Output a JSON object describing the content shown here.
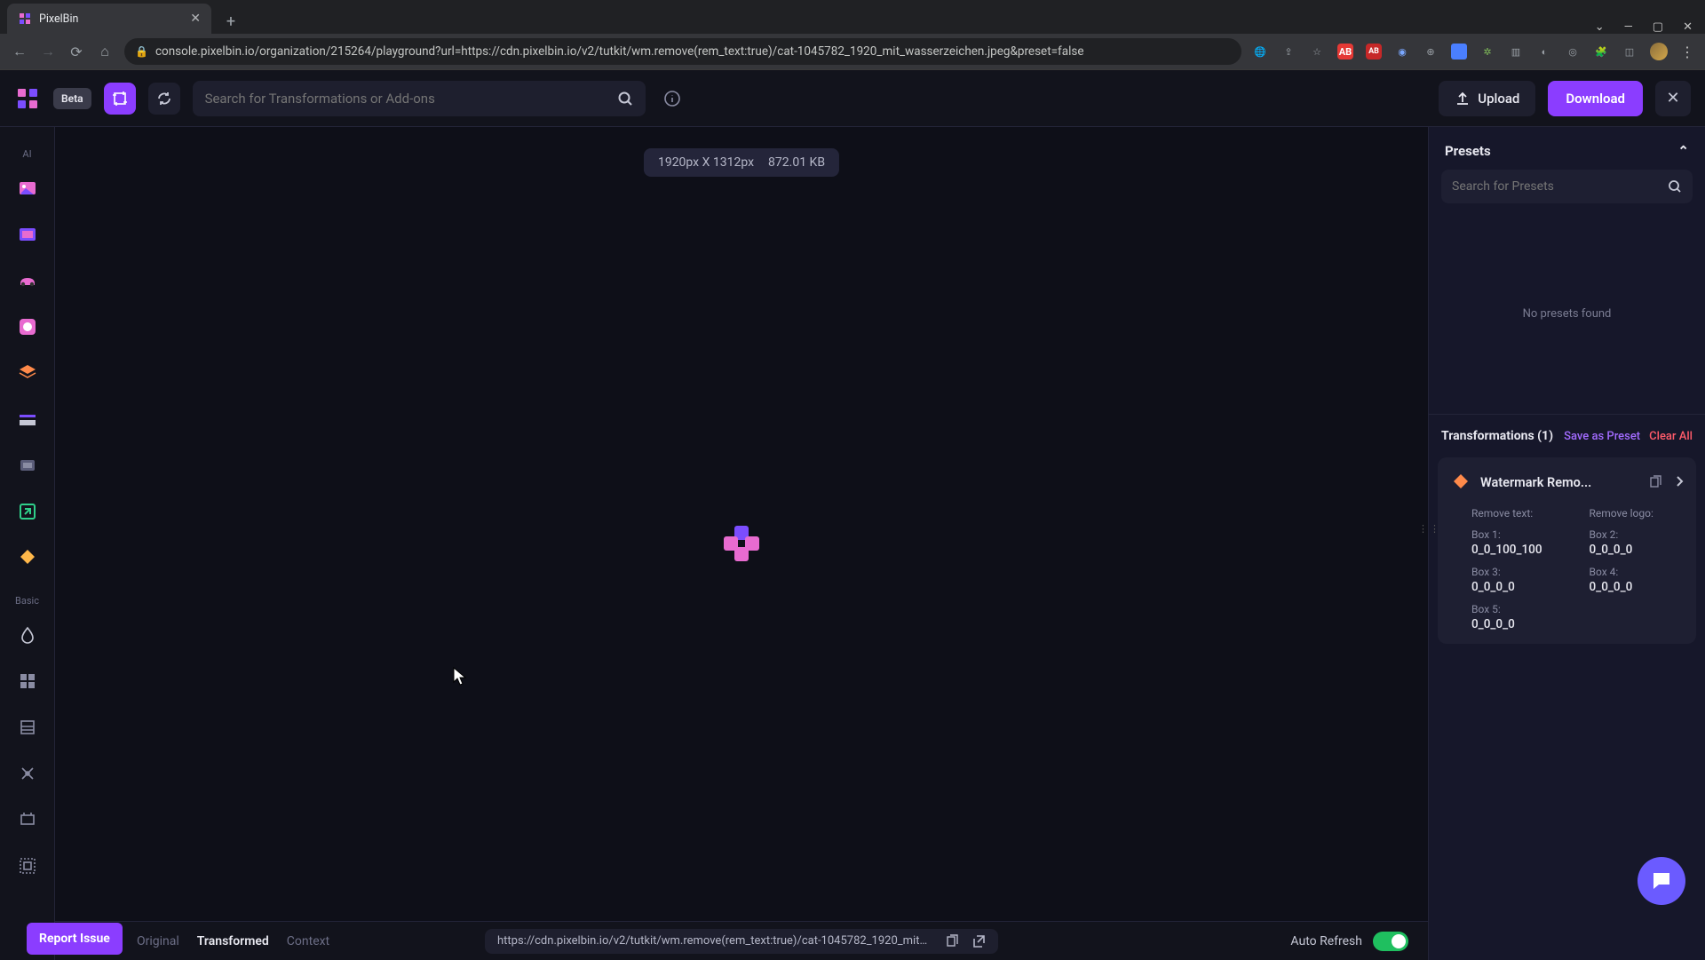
{
  "browser": {
    "tab_title": "PixelBin",
    "url": "console.pixelbin.io/organization/215264/playground?url=https://cdn.pixelbin.io/v2/tutkit/wm.remove(rem_text:true)/cat-1045782_1920_mit_wasserzeichen.jpeg&preset=false"
  },
  "header": {
    "beta": "Beta",
    "search_placeholder": "Search for Transformations or Add-ons",
    "upload": "Upload",
    "download": "Download"
  },
  "left_rail": {
    "section_ai": "AI",
    "section_basic": "Basic"
  },
  "canvas": {
    "dimensions": "1920px X 1312px",
    "filesize": "872.01 KB"
  },
  "right": {
    "presets_title": "Presets",
    "presets_placeholder": "Search for Presets",
    "presets_empty": "No presets found",
    "transformations_title": "Transformations (1)",
    "save_preset": "Save as Preset",
    "clear_all": "Clear All",
    "card": {
      "name": "Watermark Remo...",
      "params": {
        "remove_text_label": "Remove text:",
        "remove_logo_label": "Remove logo:",
        "box1_label": "Box 1:",
        "box1_val": "0_0_100_100",
        "box2_label": "Box 2:",
        "box2_val": "0_0_0_0",
        "box3_label": "Box 3:",
        "box3_val": "0_0_0_0",
        "box4_label": "Box 4:",
        "box4_val": "0_0_0_0",
        "box5_label": "Box 5:",
        "box5_val": "0_0_0_0"
      }
    }
  },
  "bottom": {
    "tab_original": "Original",
    "tab_transformed": "Transformed",
    "tab_context": "Context",
    "url_preview": "https://cdn.pixelbin.io/v2/tutkit/wm.remove(rem_text:true)/cat-1045782_1920_mit_...",
    "auto_refresh": "Auto Refresh",
    "report": "Report Issue"
  },
  "colors": {
    "accent": "#8b3dff",
    "danger": "#ff5b6a",
    "link": "#a26bff",
    "toggle_on": "#1fbf5f"
  }
}
